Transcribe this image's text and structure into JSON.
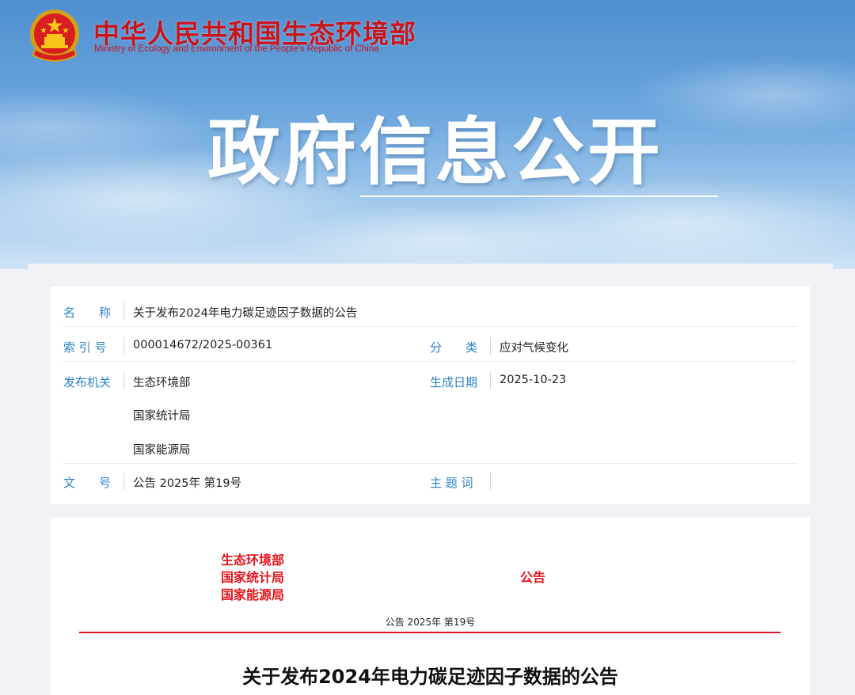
{
  "header": {
    "ministry_cn": "中华人民共和国生态环境部",
    "ministry_en": "Ministry of Ecology and Environment of the People's Republic of China",
    "emblem_icon": "national-emblem-icon",
    "banner_title": "政府信息公开"
  },
  "meta": {
    "name_label": "名　　称",
    "name_value": "关于发布2024年电力碳足迹因子数据的公告",
    "index_label": "索 引 号",
    "index_value": "000014672/2025-00361",
    "category_label": "分　　类",
    "category_value": "应对气候变化",
    "issuer_label": "发布机关",
    "issuers": [
      "生态环境部",
      "国家统计局",
      "国家能源局"
    ],
    "date_label": "生成日期",
    "date_value": "2025-10-23",
    "docno_label": "文　　号",
    "docno_value": "公告 2025年 第19号",
    "keywords_label": "主 题 词",
    "keywords_value": ""
  },
  "document": {
    "issuers": [
      "生态环境部",
      "国家统计局",
      "国家能源局"
    ],
    "doc_type": "公告",
    "doc_number": "公告 2025年 第19号",
    "title": "关于发布2024年电力碳足迹因子数据的公告"
  },
  "colors": {
    "ministry_red": "#c8151d",
    "label_blue": "#2e83c9",
    "doc_red": "#e8141b"
  }
}
